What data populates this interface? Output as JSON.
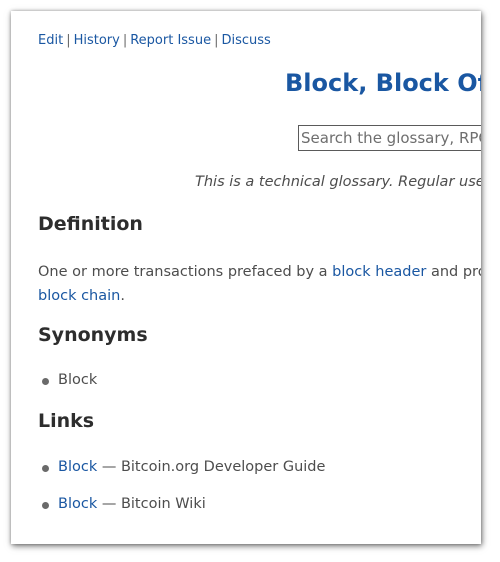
{
  "nav": {
    "edit": "Edit",
    "history": "History",
    "report_issue": "Report Issue",
    "discuss": "Discuss",
    "separator": "|"
  },
  "page_title": "Block, Block Of T",
  "search": {
    "placeholder": "Search the glossary, RPC"
  },
  "intro_text": "This is a technical glossary. Regular use",
  "definition": {
    "heading": "Definition",
    "text_before": "One or more transactions prefaced by a ",
    "link1": "block header",
    "text_middle": " and prote",
    "link2": "block chain",
    "text_after": "."
  },
  "synonyms": {
    "heading": "Synonyms",
    "items": [
      "Block"
    ]
  },
  "links": {
    "heading": "Links",
    "items": [
      {
        "link": "Block",
        "separator": " — ",
        "source": "Bitcoin.org Developer Guide"
      },
      {
        "link": "Block",
        "separator": " — ",
        "source": "Bitcoin Wiki"
      }
    ]
  },
  "colors": {
    "link": "#1a57a2",
    "text": "#4d4d4d",
    "heading": "#2d2d2d"
  }
}
